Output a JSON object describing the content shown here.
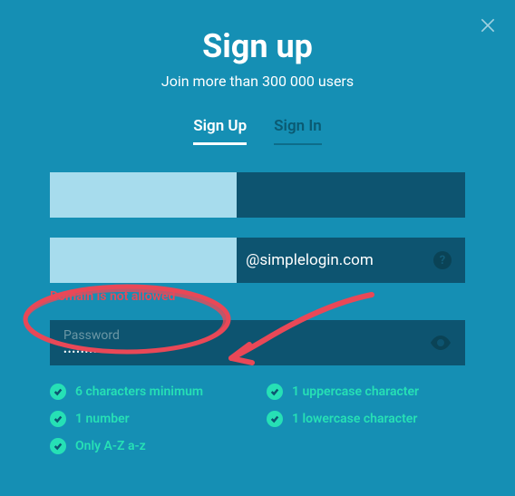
{
  "header": {
    "title": "Sign up",
    "subtitle": "Join more than 300 000 users"
  },
  "tabs": {
    "signup": "Sign Up",
    "signin": "Sign In"
  },
  "email": {
    "domain": "@simplelogin.com"
  },
  "error": "Domain is not allowed",
  "password": {
    "placeholder": "Password",
    "dots": "•••••••••••••••••"
  },
  "reqs": {
    "r1": "6 characters minimum",
    "r2": "1 uppercase character",
    "r3": "1 number",
    "r4": "1 lowercase character",
    "r5": "Only A-Z a-z"
  }
}
